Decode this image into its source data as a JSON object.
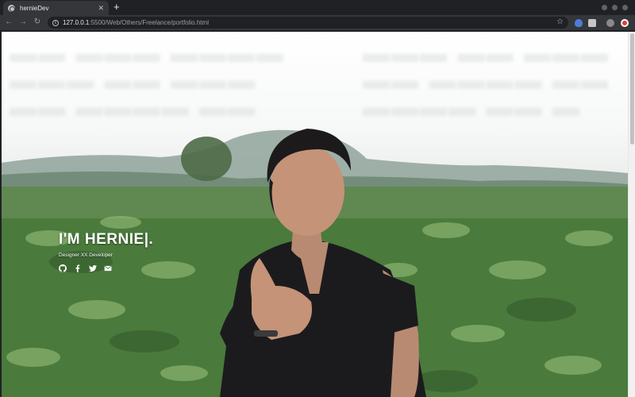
{
  "browser": {
    "tab_title": "hernieDev",
    "tab_close_icon": "close-icon",
    "new_tab_label": "+",
    "url_host": "127.0.0.1",
    "url_path": ":5500/Web/Others/Freelance/portfolio.html"
  },
  "hero": {
    "name": "I'M HERNIE|.",
    "role": "Designer XX Developer",
    "socials": [
      "github-icon",
      "facebook-icon",
      "twitter-icon",
      "email-icon"
    ]
  },
  "colors": {
    "browser_bg": "#202124",
    "toolbar_bg": "#35363a",
    "hero_text": "#ffffff"
  }
}
